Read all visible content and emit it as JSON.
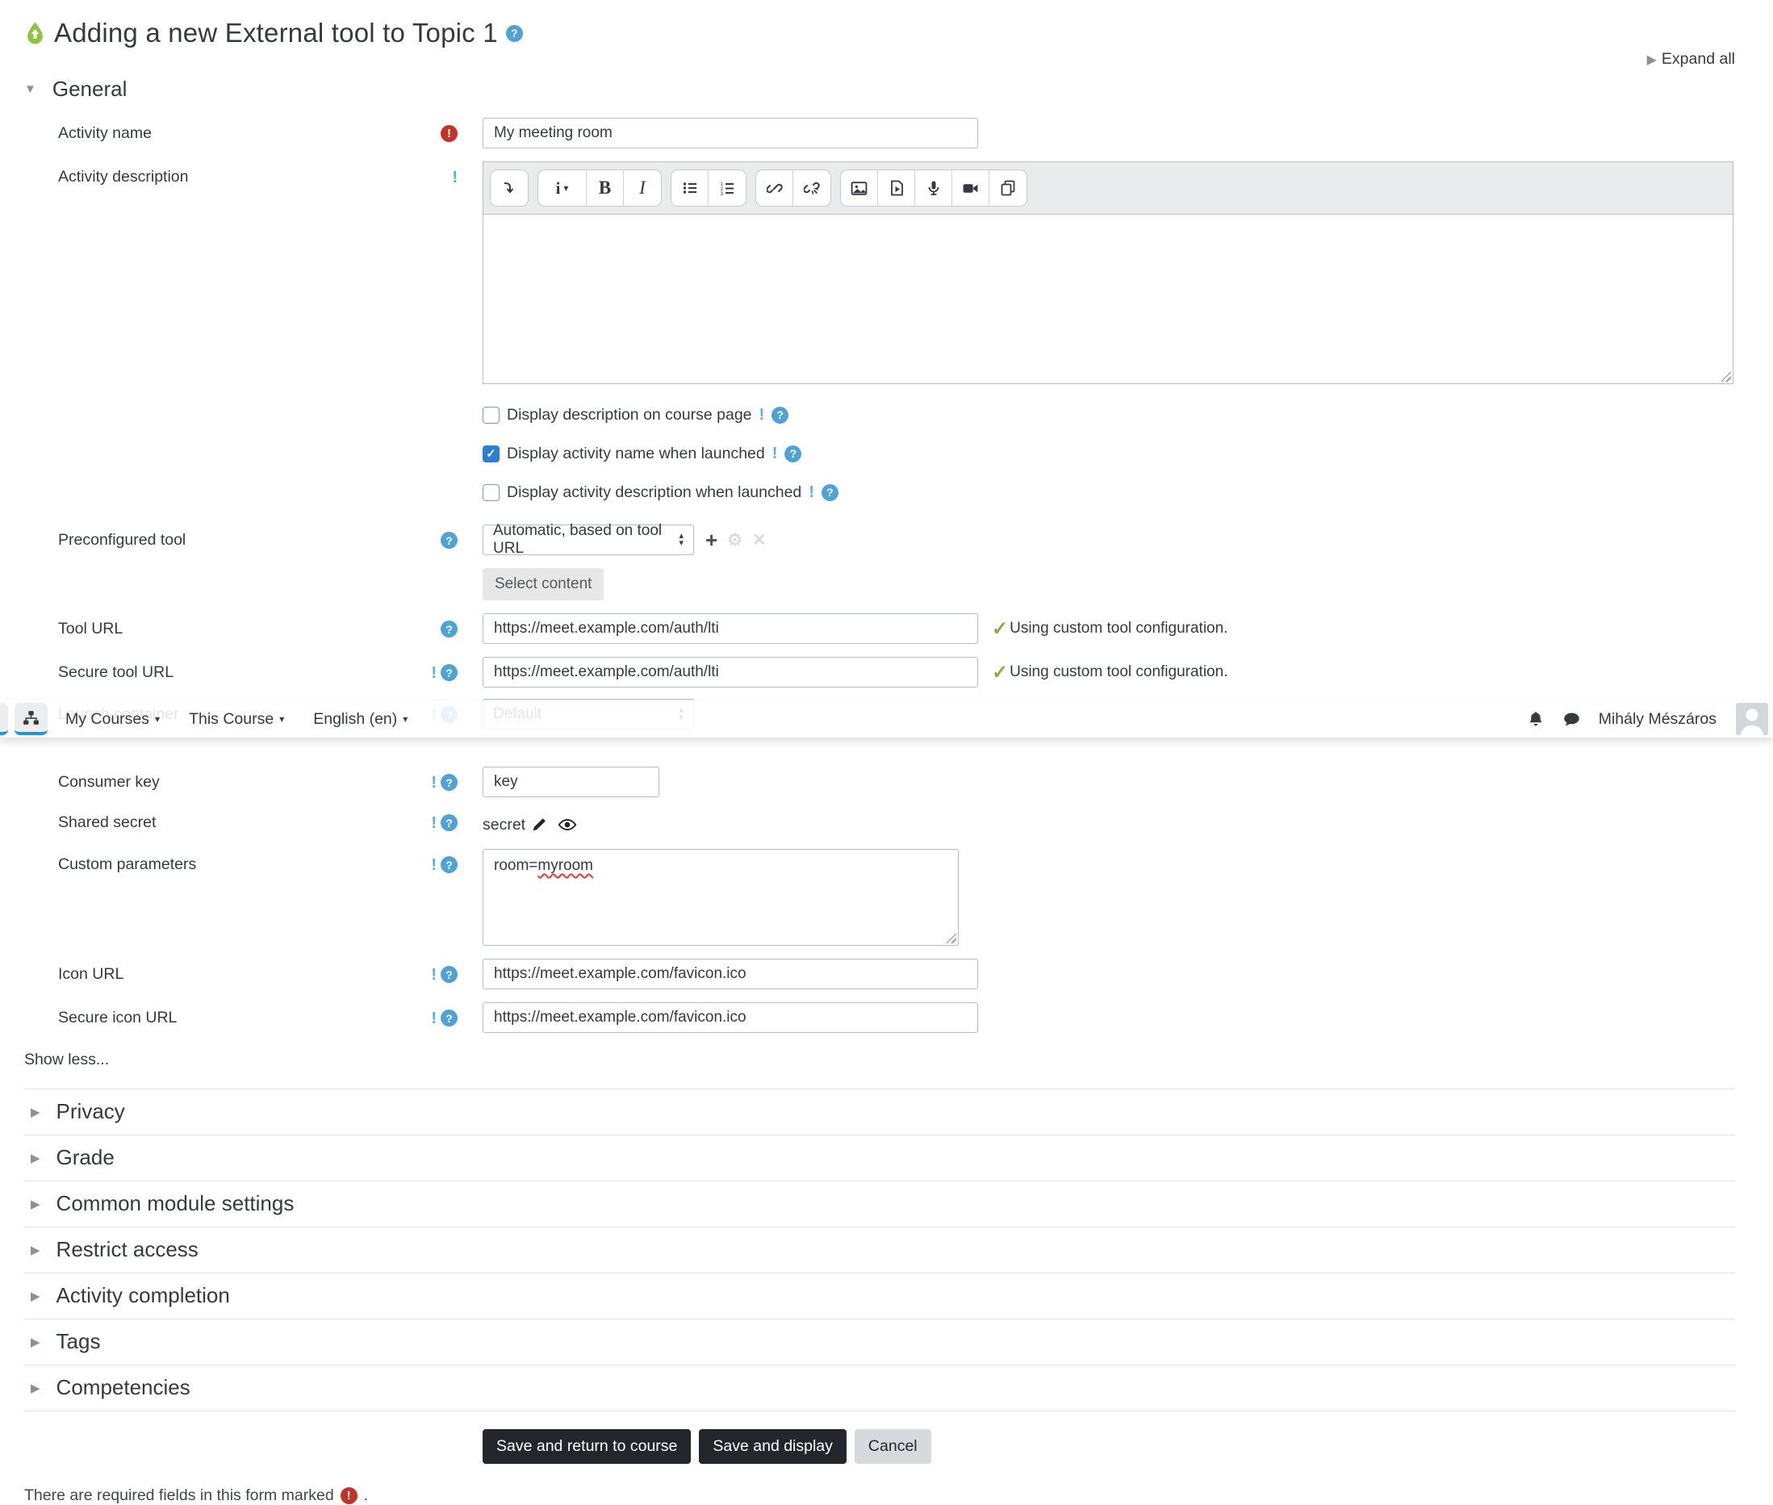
{
  "page": {
    "title": "Adding a new External tool to Topic 1",
    "expand_all": "Expand all",
    "required_note": "There are required fields in this form marked",
    "required_note_suffix": "."
  },
  "navbar": {
    "items": [
      {
        "label": "My Courses"
      },
      {
        "label": "This Course"
      },
      {
        "label": "English (en)"
      }
    ],
    "user_name": "Mihály Mészáros",
    "icons": [
      "sitemap-icon",
      "bell-icon",
      "chat-icon",
      "avatar"
    ]
  },
  "general": {
    "heading": "General",
    "activity_name": {
      "label": "Activity name",
      "value": "My meeting room"
    },
    "activity_description": {
      "label": "Activity description",
      "value": ""
    },
    "checkboxes": [
      {
        "label": "Display description on course page",
        "checked": false
      },
      {
        "label": "Display activity name when launched",
        "checked": true
      },
      {
        "label": "Display activity description when launched",
        "checked": false
      }
    ],
    "preconfigured_tool": {
      "label": "Preconfigured tool",
      "value": "Automatic, based on tool URL",
      "select_content_label": "Select content"
    },
    "tool_url": {
      "label": "Tool URL",
      "value": "https://meet.example.com/auth/lti",
      "status": "Using custom tool configuration."
    },
    "secure_tool_url": {
      "label": "Secure tool URL",
      "value": "https://meet.example.com/auth/lti",
      "status": "Using custom tool configuration."
    },
    "launch_container": {
      "label": "Launch container",
      "value": "Default"
    },
    "consumer_key": {
      "label": "Consumer key",
      "value": "key"
    },
    "shared_secret": {
      "label": "Shared secret",
      "value": "secret"
    },
    "custom_parameters": {
      "label": "Custom parameters",
      "value": "room=myroom",
      "value_prefix": "room=",
      "value_misspelled": "myroom"
    },
    "icon_url": {
      "label": "Icon URL",
      "value": "https://meet.example.com/favicon.ico"
    },
    "secure_icon_url": {
      "label": "Secure icon URL",
      "value": "https://meet.example.com/favicon.ico"
    },
    "show_less": "Show less..."
  },
  "sections": [
    {
      "label": "Privacy"
    },
    {
      "label": "Grade"
    },
    {
      "label": "Common module settings"
    },
    {
      "label": "Restrict access"
    },
    {
      "label": "Activity completion"
    },
    {
      "label": "Tags"
    },
    {
      "label": "Competencies"
    }
  ],
  "buttons": {
    "save_return": "Save and return to course",
    "save_display": "Save and display",
    "cancel": "Cancel"
  },
  "editor": {
    "toolbar_icons": [
      "collapse-toolbar-icon",
      "paragraph-style-icon",
      "bold-icon",
      "italic-icon",
      "unordered-list-icon",
      "ordered-list-icon",
      "link-icon",
      "unlink-icon",
      "image-icon",
      "media-icon",
      "record-audio-icon",
      "record-video-icon",
      "manage-files-icon"
    ]
  },
  "colors": {
    "help_blue": "#4fa3d4",
    "advanced_blue": "#58b0dc",
    "required_red": "#c43229",
    "success_green": "#84b042",
    "checkbox_blue": "#2e7fd2",
    "nav_underline_blue": "#2492db",
    "dark_button": "#23272c",
    "tool_icon_green": "#90c43c"
  }
}
